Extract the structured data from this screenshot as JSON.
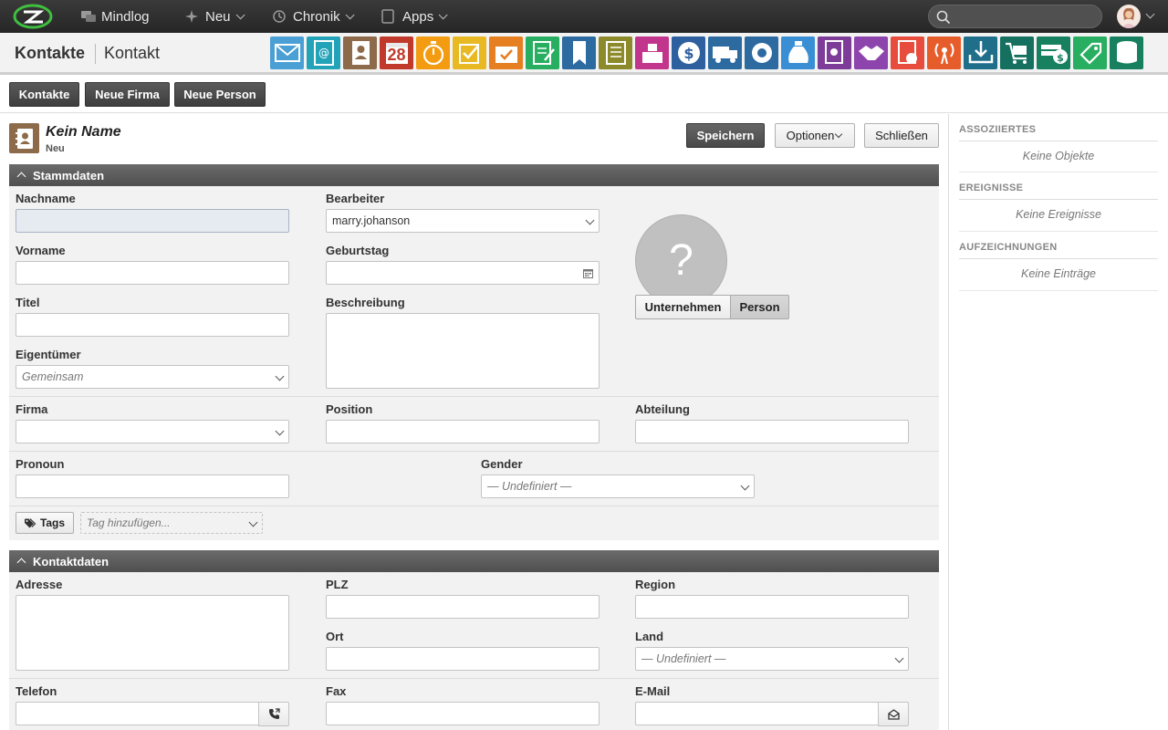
{
  "topbar": {
    "items": [
      {
        "label": "Mindlog",
        "icon": "chat-icon"
      },
      {
        "label": "Neu",
        "icon": "sparkle-icon"
      },
      {
        "label": "Chronik",
        "icon": "history-icon"
      },
      {
        "label": "Apps",
        "icon": "tablet-icon"
      }
    ],
    "search_placeholder": ""
  },
  "header": {
    "title": "Kontakte",
    "subtitle": "Kontakt",
    "app_icons": [
      {
        "name": "mail-app-icon",
        "color": "#4a9fd4"
      },
      {
        "name": "email-address-app-icon",
        "color": "#23a3b8"
      },
      {
        "name": "contacts-app-icon",
        "color": "#8c6a4a"
      },
      {
        "name": "calendar-app-icon",
        "color": "#c0392b",
        "text": "28"
      },
      {
        "name": "timer-app-icon",
        "color": "#f39c12"
      },
      {
        "name": "tasks-app-icon",
        "color": "#e8b923"
      },
      {
        "name": "projects-app-icon",
        "color": "#e67e22"
      },
      {
        "name": "notes-app-icon",
        "color": "#27ae60"
      },
      {
        "name": "bookmarks-app-icon",
        "color": "#2c6aa0"
      },
      {
        "name": "documents-app-icon",
        "color": "#8d8a2b"
      },
      {
        "name": "shop-app-icon",
        "color": "#c2358c"
      },
      {
        "name": "finance-app-icon",
        "color": "#2e5f9e"
      },
      {
        "name": "delivery-app-icon",
        "color": "#2c6aa0"
      },
      {
        "name": "support-app-icon",
        "color": "#2c6aa0"
      },
      {
        "name": "money-bag-app-icon",
        "color": "#3a8fd4"
      },
      {
        "name": "contract-app-icon",
        "color": "#7d3c98"
      },
      {
        "name": "handshake-app-icon",
        "color": "#8e44ad"
      },
      {
        "name": "pdf-app-icon",
        "color": "#e74c3c"
      },
      {
        "name": "broadcast-app-icon",
        "color": "#e65c2a"
      },
      {
        "name": "download-app-icon",
        "color": "#1f6f8b"
      },
      {
        "name": "cart-app-icon",
        "color": "#16705f"
      },
      {
        "name": "cash-app-icon",
        "color": "#16805f"
      },
      {
        "name": "price-tag-app-icon",
        "color": "#27ae60"
      },
      {
        "name": "database-app-icon",
        "color": "#16805f"
      }
    ]
  },
  "subbar": {
    "buttons": [
      "Kontakte",
      "Neue Firma",
      "Neue Person"
    ]
  },
  "record": {
    "title": "Kein Name",
    "subtitle": "Neu",
    "save_label": "Speichern",
    "options_label": "Optionen",
    "close_label": "Schließen"
  },
  "stammdaten": {
    "section_title": "Stammdaten",
    "nachname_label": "Nachname",
    "nachname_value": "",
    "vorname_label": "Vorname",
    "titel_label": "Titel",
    "eigentuemer_label": "Eigentümer",
    "eigentuemer_value": "Gemeinsam",
    "bearbeiter_label": "Bearbeiter",
    "bearbeiter_value": "marry.johanson",
    "geburtstag_label": "Geburtstag",
    "beschreibung_label": "Beschreibung",
    "photo_placeholder": "?",
    "type_options": [
      "Unternehmen",
      "Person"
    ],
    "type_selected": "Person",
    "firma_label": "Firma",
    "position_label": "Position",
    "abteilung_label": "Abteilung",
    "pronoun_label": "Pronoun",
    "gender_label": "Gender",
    "gender_value": "— Undefiniert —",
    "tags_label": "Tags",
    "tag_placeholder": "Tag hinzufügen..."
  },
  "kontaktdaten": {
    "section_title": "Kontaktdaten",
    "adresse_label": "Adresse",
    "plz_label": "PLZ",
    "region_label": "Region",
    "ort_label": "Ort",
    "land_label": "Land",
    "land_value": "— Undefiniert —",
    "telefon_label": "Telefon",
    "fax_label": "Fax",
    "email_label": "E-Mail"
  },
  "sidebar": {
    "sections": [
      {
        "title": "ASSOZIIERTES",
        "empty": "Keine Objekte"
      },
      {
        "title": "EREIGNISSE",
        "empty": "Keine Ereignisse"
      },
      {
        "title": "AUFZEICHNUNGEN",
        "empty": "Keine Einträge"
      }
    ]
  }
}
